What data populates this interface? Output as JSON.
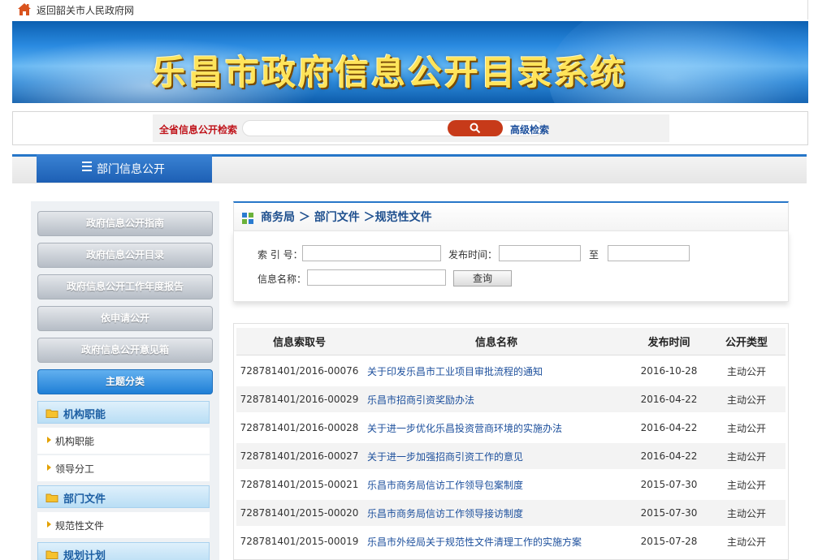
{
  "topbar": {
    "link": "返回韶关市人民政府网"
  },
  "banner": {
    "title": "乐昌市政府信息公开目录系统"
  },
  "search": {
    "label": "全省信息公开检索",
    "button_icon": "search-icon",
    "advanced": "高级检索"
  },
  "nav": {
    "tab": "部门信息公开",
    "tab_icon": "menu-icon"
  },
  "sidebar": {
    "buttons": [
      "政府信息公开指南",
      "政府信息公开目录",
      "政府信息公开工作年度报告",
      "依申请公开",
      "政府信息公开意见箱"
    ],
    "topic_button": "主题分类",
    "categories": [
      {
        "title": "机构职能",
        "items": [
          "机构职能",
          "领导分工"
        ]
      },
      {
        "title": "部门文件",
        "items": [
          "规范性文件"
        ]
      },
      {
        "title": "规划计划",
        "items": []
      }
    ]
  },
  "breadcrumb": {
    "text": "商务局 ＞ 部门文件 ＞规范性文件"
  },
  "filter": {
    "index_label": "索 引 号：",
    "date_label": "发布时间：",
    "to_label": "至",
    "name_label": "信息名称：",
    "query_button": "查询"
  },
  "table": {
    "headers": [
      "信息索取号",
      "信息名称",
      "发布时间",
      "公开类型"
    ],
    "rows": [
      {
        "id": "728781401/2016-00076",
        "name": "关于印发乐昌市工业项目审批流程的通知",
        "date": "2016-10-28",
        "type": "主动公开"
      },
      {
        "id": "728781401/2016-00029",
        "name": "乐昌市招商引资奖励办法",
        "date": "2016-04-22",
        "type": "主动公开"
      },
      {
        "id": "728781401/2016-00028",
        "name": "关于进一步优化乐昌投资营商环境的实施办法",
        "date": "2016-04-22",
        "type": "主动公开"
      },
      {
        "id": "728781401/2016-00027",
        "name": "关于进一步加强招商引资工作的意见",
        "date": "2016-04-22",
        "type": "主动公开"
      },
      {
        "id": "728781401/2015-00021",
        "name": "乐昌市商务局信访工作领导包案制度",
        "date": "2015-07-30",
        "type": "主动公开"
      },
      {
        "id": "728781401/2015-00020",
        "name": "乐昌市商务局信访工作领导接访制度",
        "date": "2015-07-30",
        "type": "主动公开"
      },
      {
        "id": "728781401/2015-00019",
        "name": "乐昌市外经局关于规范性文件清理工作的实施方案",
        "date": "2015-07-28",
        "type": "主动公开"
      }
    ]
  }
}
